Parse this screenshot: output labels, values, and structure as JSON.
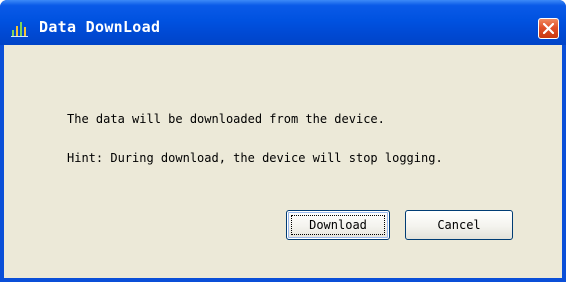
{
  "window": {
    "title": "Data DownLoad",
    "icon": "chart-bars-icon",
    "close_icon": "close-x-icon"
  },
  "dialog": {
    "message": "The data will be downloaded from the device.",
    "hint": "Hint: During download, the device will stop logging."
  },
  "buttons": {
    "download_label": "Download",
    "cancel_label": "Cancel"
  },
  "colors": {
    "titlebar": "#0052e0",
    "client_background": "#ece9d8",
    "close_button": "#e0502a"
  }
}
